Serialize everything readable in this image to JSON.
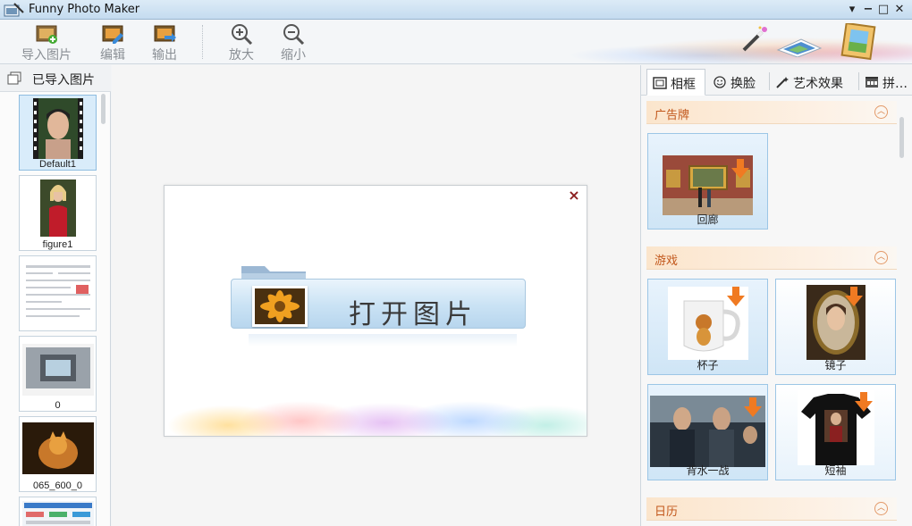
{
  "window": {
    "title": "Funny Photo Maker",
    "controls": [
      "▾",
      "−",
      "□",
      "✕"
    ]
  },
  "toolbar": {
    "import_label": "导入图片",
    "edit_label": "编辑",
    "export_label": "输出",
    "zoom_in_label": "放大",
    "zoom_out_label": "缩小"
  },
  "left_panel": {
    "header": "已导入图片",
    "items": [
      {
        "caption": "Default1",
        "selected": true
      },
      {
        "caption": "figure1",
        "selected": false
      },
      {
        "caption": "",
        "selected": false
      },
      {
        "caption": "0",
        "selected": false
      },
      {
        "caption": "065_600_0",
        "selected": false
      },
      {
        "caption": "",
        "selected": false
      }
    ]
  },
  "center": {
    "open_button_label": "打开图片",
    "close_symbol": "×"
  },
  "right_panel": {
    "tabs": [
      {
        "label": "相框",
        "active": true
      },
      {
        "label": "换脸",
        "active": false
      },
      {
        "label": "艺术效果",
        "active": false
      },
      {
        "label": "拼…",
        "active": false
      }
    ],
    "sections": [
      {
        "title": "广告牌",
        "items": [
          {
            "caption": "回廊"
          }
        ]
      },
      {
        "title": "游戏",
        "items": [
          {
            "caption": "杯子"
          },
          {
            "caption": "镜子"
          },
          {
            "caption": "背水一战"
          },
          {
            "caption": "短袖"
          }
        ]
      },
      {
        "title": "日历",
        "items": []
      }
    ],
    "collapse_symbol": "︿"
  },
  "colors": {
    "accent": "#9cc6e6",
    "section_text": "#c2571b",
    "download_arrow": "#f07a22"
  }
}
